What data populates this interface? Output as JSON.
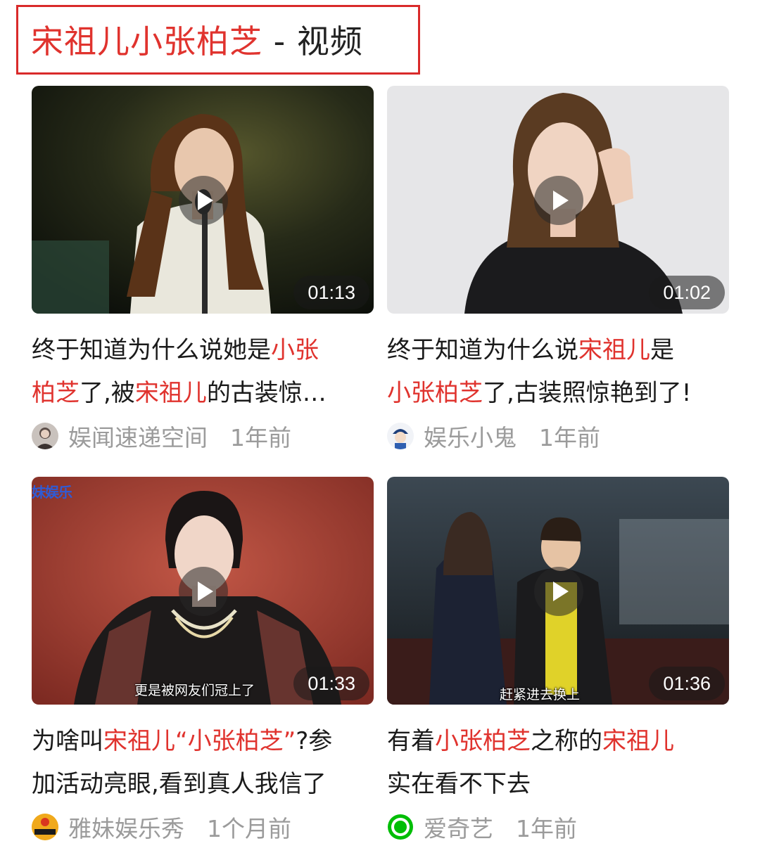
{
  "header": {
    "keyword": "宋祖儿小张柏芝",
    "separator": " - ",
    "section": "视频"
  },
  "videos": [
    {
      "duration": "01:13",
      "title_lines": [
        [
          {
            "t": "终于知道为什么说她是",
            "h": false
          },
          {
            "t": "小张",
            "h": true
          }
        ],
        [
          {
            "t": "柏芝",
            "h": true
          },
          {
            "t": "了,被",
            "h": false
          },
          {
            "t": "宋祖儿",
            "h": true
          },
          {
            "t": "的古装惊…",
            "h": false
          }
        ]
      ],
      "author": "娱闻速递空间",
      "time": "1年前",
      "avatar": "person-avatar"
    },
    {
      "duration": "01:02",
      "title_lines": [
        [
          {
            "t": "终于知道为什么说",
            "h": false
          },
          {
            "t": "宋祖儿",
            "h": true
          },
          {
            "t": "是",
            "h": false
          }
        ],
        [
          {
            "t": "小张柏芝",
            "h": true
          },
          {
            "t": "了,古装照惊艳到了!",
            "h": false
          }
        ]
      ],
      "author": "娱乐小鬼",
      "time": "1年前",
      "avatar": "cartoon-avatar"
    },
    {
      "duration": "01:33",
      "subtitle": "更是被网友们冠上了",
      "corner_logo": "妹娱乐",
      "title_lines": [
        [
          {
            "t": "为啥叫",
            "h": false
          },
          {
            "t": "宋祖儿",
            "h": true
          },
          {
            "t": "“小张柏芝”",
            "h": true
          },
          {
            "t": "?参",
            "h": false
          }
        ],
        [
          {
            "t": "加活动亮眼,看到真人我信了",
            "h": false
          }
        ]
      ],
      "author": "雅妹娱乐秀",
      "time": "1个月前",
      "avatar": "venue-logo-avatar"
    },
    {
      "duration": "01:36",
      "subtitle": "赶紧进去换上",
      "title_lines": [
        [
          {
            "t": "有着",
            "h": false
          },
          {
            "t": "小张柏芝",
            "h": true
          },
          {
            "t": "之称的",
            "h": false
          },
          {
            "t": "宋祖儿",
            "h": true
          }
        ],
        [
          {
            "t": "实在看不下去",
            "h": false
          }
        ]
      ],
      "author": "爱奇艺",
      "time": "1年前",
      "avatar": "iqiyi-logo-avatar"
    }
  ],
  "colors": {
    "highlight": "#e0332e",
    "text": "#1a1a1a",
    "meta": "#9b9b9b",
    "header_border": "#d92a2a"
  }
}
